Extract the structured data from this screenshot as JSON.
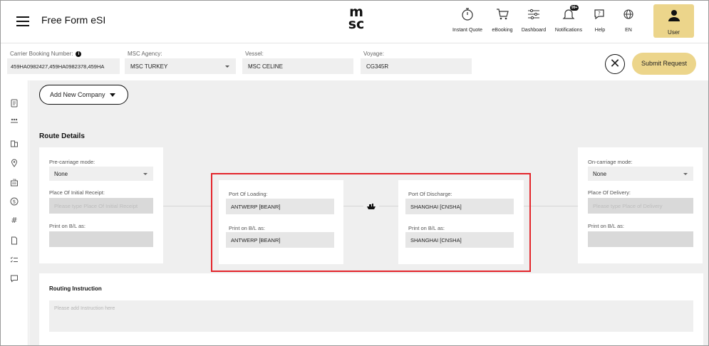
{
  "app": {
    "title": "Free Form eSI",
    "logo_text": "msc"
  },
  "nav": [
    {
      "name": "instant-quote",
      "label": "Instant Quote",
      "icon": "stopwatch-icon"
    },
    {
      "name": "ebooking",
      "label": "eBooking",
      "icon": "cart-icon"
    },
    {
      "name": "dashboard",
      "label": "Dashboard",
      "icon": "sliders-icon"
    },
    {
      "name": "notifications",
      "label": "Notifications",
      "icon": "bell-icon",
      "badge": "99+"
    },
    {
      "name": "help",
      "label": "Help",
      "icon": "help-chat-icon"
    },
    {
      "name": "language",
      "label": "EN",
      "icon": "globe-icon"
    }
  ],
  "user": {
    "label": "User"
  },
  "booking": {
    "carrier_label": "Carrier Booking Number:",
    "carrier_value": "459HA0982427,459HA0982378,459HA",
    "agency_label": "MSC Agency:",
    "agency_value": "MSC TURKEY",
    "vessel_label": "Vessel:",
    "vessel_value": "MSC CELINE",
    "voyage_label": "Voyage:",
    "voyage_value": "CG345R",
    "submit_label": "Submit Request",
    "close_symbol": "✕"
  },
  "main": {
    "add_company_label": "Add New Company",
    "route_title": "Route Details"
  },
  "pre_carriage": {
    "mode_label": "Pre-carriage mode:",
    "mode_value": "None",
    "receipt_label": "Place Of Initial Receipt:",
    "receipt_placeholder": "Please type Place Of Initial Receipt",
    "print_label": "Print on B/L as:"
  },
  "loading": {
    "port_label": "Port Of Loading:",
    "port_value": "ANTWERP [BEANR]",
    "print_label": "Print on B/L as:",
    "print_value": "ANTWERP [BEANR]"
  },
  "discharge": {
    "port_label": "Port Of Discharge:",
    "port_value": "SHANGHAI [CNSHA]",
    "print_label": "Print on B/L as:",
    "print_value": "SHANGHAI [CNSHA]"
  },
  "on_carriage": {
    "mode_label": "On-carriage mode:",
    "mode_value": "None",
    "delivery_label": "Place Of Delivery:",
    "delivery_placeholder": "Please type Place of Delivery",
    "print_label": "Print on B/L as:"
  },
  "routing": {
    "title": "Routing Instruction",
    "placeholder": "Please add Instruction here"
  },
  "colors": {
    "accent": "#ecd58b",
    "highlight": "#e3252b",
    "background": "#efefef"
  }
}
